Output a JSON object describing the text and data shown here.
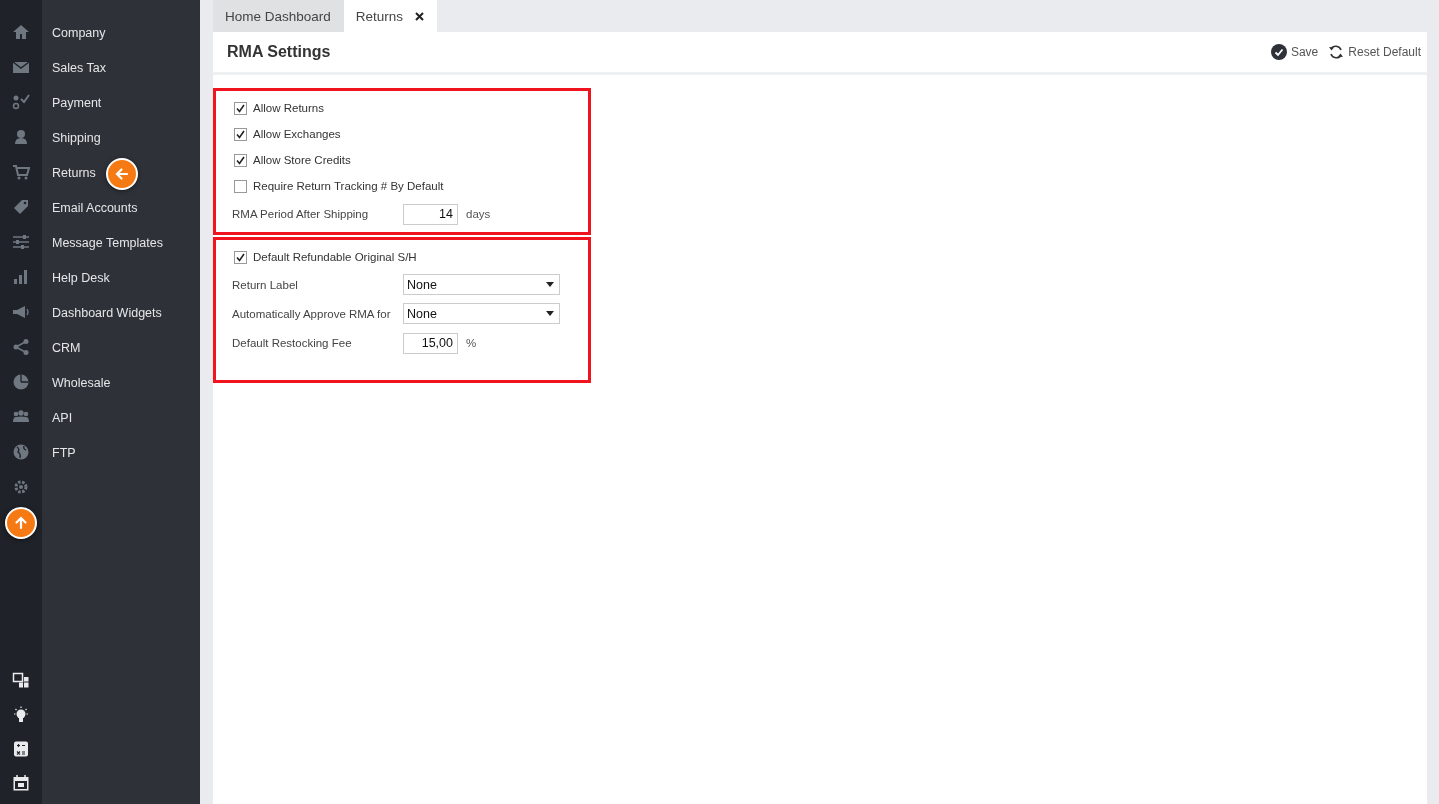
{
  "sidebar": {
    "items": [
      {
        "label": "Company"
      },
      {
        "label": "Sales Tax"
      },
      {
        "label": "Payment"
      },
      {
        "label": "Shipping"
      },
      {
        "label": "Returns",
        "callout": true
      },
      {
        "label": "Email Accounts"
      },
      {
        "label": "Message Templates"
      },
      {
        "label": "Help Desk"
      },
      {
        "label": "Dashboard Widgets"
      },
      {
        "label": "CRM"
      },
      {
        "label": "Wholesale"
      },
      {
        "label": "API"
      },
      {
        "label": "FTP"
      }
    ]
  },
  "tabs": [
    {
      "label": "Home Dashboard",
      "selected": false,
      "closable": false
    },
    {
      "label": "Returns",
      "selected": true,
      "closable": true
    }
  ],
  "header": {
    "title": "RMA Settings",
    "actions": [
      {
        "label": "Save",
        "kind": "save"
      },
      {
        "label": "Reset Default",
        "kind": "reset"
      }
    ]
  },
  "sections": [
    {
      "highlighted": true,
      "rows": [
        {
          "kind": "checkbox",
          "label": "Allow Returns",
          "checked": true
        },
        {
          "kind": "checkbox",
          "label": "Allow Exchanges",
          "checked": true
        },
        {
          "kind": "checkbox",
          "label": "Allow Store Credits",
          "checked": true
        },
        {
          "kind": "checkbox",
          "label": "Require Return Tracking # By Default",
          "checked": false
        },
        {
          "kind": "number",
          "label": "RMA Period After Shipping",
          "value": "14",
          "unit": "days"
        }
      ]
    },
    {
      "highlighted": true,
      "rows": [
        {
          "kind": "checkbox",
          "label": "Default Refundable Original S/H",
          "checked": true
        },
        {
          "kind": "select",
          "label": "Return Label",
          "value": "None"
        },
        {
          "kind": "select",
          "label": "Automatically Approve RMA for",
          "value": "None"
        },
        {
          "kind": "number",
          "label": "Default Restocking Fee",
          "value": "15,00",
          "unit": "%"
        }
      ]
    }
  ]
}
